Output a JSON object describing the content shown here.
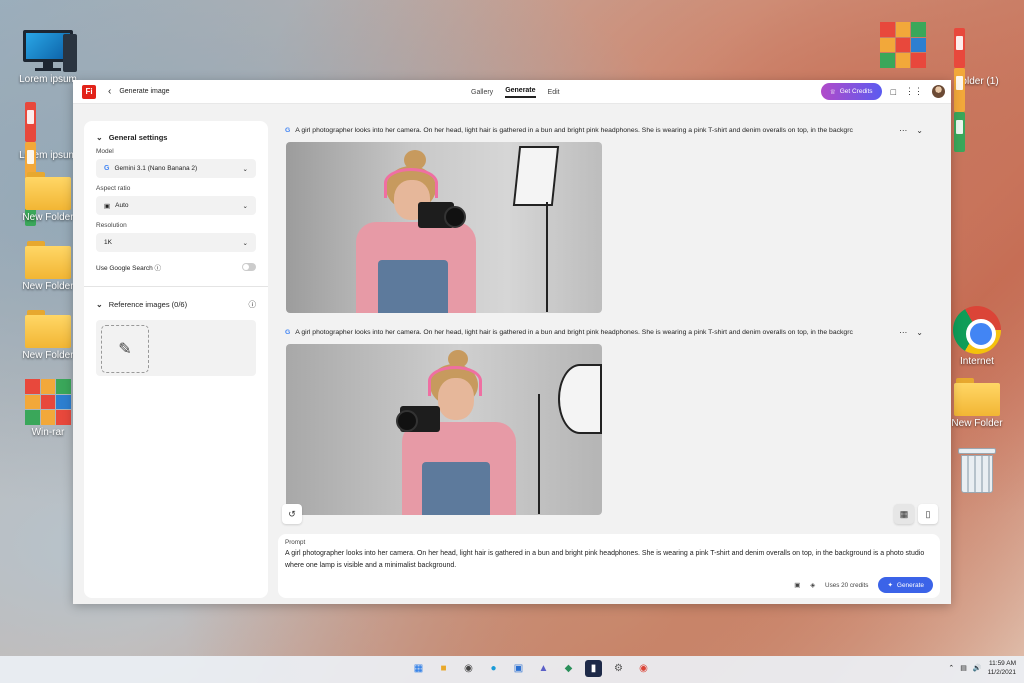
{
  "desktop": {
    "left_icons": [
      "Lorem ipsum",
      "Lorem ipsum",
      "New Folder",
      "New Folder",
      "New Folder",
      "Win-rar"
    ],
    "right_icons": [
      "",
      "Folder (1)",
      "Internet",
      "New Folder",
      ""
    ]
  },
  "app": {
    "logo": "Fi",
    "breadcrumb": "Generate image",
    "tabs": [
      "Gallery",
      "Generate",
      "Edit"
    ],
    "active_tab": "Generate",
    "credits_label": "Get Credits"
  },
  "settings": {
    "title": "General settings",
    "model_label": "Model",
    "model_value": "Gemini 3.1 (Nano Banana 2)",
    "aspect_label": "Aspect ratio",
    "aspect_value": "Auto",
    "resolution_label": "Resolution",
    "resolution_value": "1K",
    "google_search_label": "Use Google Search",
    "google_search_on": false
  },
  "reference": {
    "title": "Reference images (0/6)"
  },
  "results": [
    {
      "prompt": "A girl photographer looks into her camera. On her head, light hair is gathered in a bun and bright pink headphones. She is wearing a pink T-shirt and denim overalls on top, in the backgrc"
    },
    {
      "prompt": "A girl photographer looks into her camera. On her head, light hair is gathered in a bun and bright pink headphones. She is wearing a pink T-shirt and denim overalls on top, in the backgrc"
    }
  ],
  "prompt_box": {
    "label": "Prompt",
    "value": "A girl photographer looks into her camera. On her head, light hair is gathered in a bun and bright pink headphones. She is wearing a pink T-shirt and denim overalls on top, in the background is a photo studio where one lamp is visible and a minimalist background.",
    "credits_text": "Uses 20 credits",
    "generate_label": "Generate"
  },
  "taskbar": {
    "time": "11:59 AM",
    "date": "11/2/2021"
  },
  "colors": {
    "accent": "#3b63e8",
    "brand": "#e2231a",
    "credits_gradient": [
      "#b14bc9",
      "#5b5bf0"
    ]
  }
}
